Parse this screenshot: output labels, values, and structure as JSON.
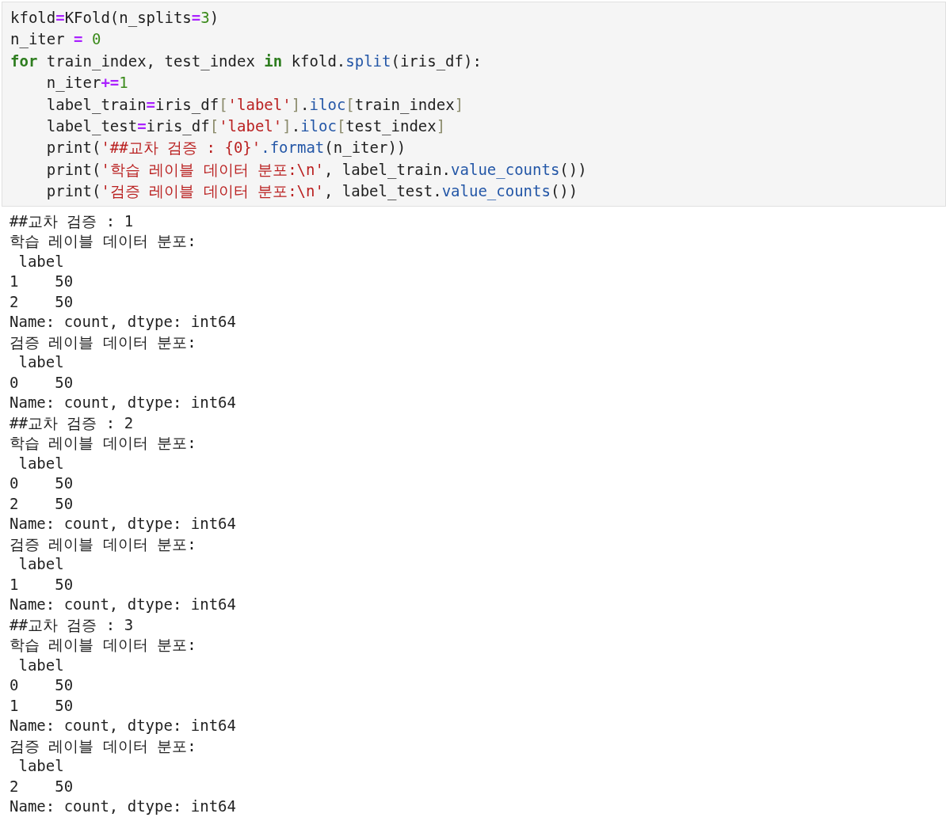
{
  "code_cell": {
    "lines": [
      [
        {
          "text": "kfold",
          "kind": "plain"
        },
        {
          "text": "=",
          "kind": "operator"
        },
        {
          "text": "KFold(n_splits",
          "kind": "plain"
        },
        {
          "text": "=",
          "kind": "operator"
        },
        {
          "text": "3",
          "kind": "number"
        },
        {
          "text": ")",
          "kind": "plain"
        }
      ],
      [
        {
          "text": "n_iter ",
          "kind": "plain"
        },
        {
          "text": "=",
          "kind": "operator"
        },
        {
          "text": " 0",
          "kind": "number"
        }
      ],
      [
        {
          "text": "for",
          "kind": "keyword"
        },
        {
          "text": " train_index, test_index ",
          "kind": "plain"
        },
        {
          "text": "in",
          "kind": "keyword"
        },
        {
          "text": " kfold.",
          "kind": "plain"
        },
        {
          "text": "split",
          "kind": "method"
        },
        {
          "text": "(iris_df):",
          "kind": "plain"
        }
      ],
      [
        {
          "text": "    n_iter",
          "kind": "plain"
        },
        {
          "text": "+=",
          "kind": "operator"
        },
        {
          "text": "1",
          "kind": "number"
        }
      ],
      [
        {
          "text": "    label_train",
          "kind": "plain"
        },
        {
          "text": "=",
          "kind": "operator"
        },
        {
          "text": "iris_df",
          "kind": "plain"
        },
        {
          "text": "[",
          "kind": "bracket"
        },
        {
          "text": "'label'",
          "kind": "string"
        },
        {
          "text": "]",
          "kind": "bracket"
        },
        {
          "text": ".",
          "kind": "plain"
        },
        {
          "text": "iloc",
          "kind": "method"
        },
        {
          "text": "[",
          "kind": "bracket"
        },
        {
          "text": "train_index",
          "kind": "plain"
        },
        {
          "text": "]",
          "kind": "bracket"
        }
      ],
      [
        {
          "text": "    label_test",
          "kind": "plain"
        },
        {
          "text": "=",
          "kind": "operator"
        },
        {
          "text": "iris_df",
          "kind": "plain"
        },
        {
          "text": "[",
          "kind": "bracket"
        },
        {
          "text": "'label'",
          "kind": "string"
        },
        {
          "text": "]",
          "kind": "bracket"
        },
        {
          "text": ".",
          "kind": "plain"
        },
        {
          "text": "iloc",
          "kind": "method"
        },
        {
          "text": "[",
          "kind": "bracket"
        },
        {
          "text": "test_index",
          "kind": "plain"
        },
        {
          "text": "]",
          "kind": "bracket"
        }
      ],
      [
        {
          "text": "    print(",
          "kind": "plain"
        },
        {
          "text": "'##교차 검증 : {0}'",
          "kind": "string"
        },
        {
          "text": ".format",
          "kind": "method"
        },
        {
          "text": "(n_iter))",
          "kind": "plain"
        }
      ],
      [
        {
          "text": "    print(",
          "kind": "plain"
        },
        {
          "text": "'학습 레이블 데이터 분포:\\n'",
          "kind": "string"
        },
        {
          "text": ", label_train.",
          "kind": "plain"
        },
        {
          "text": "value_counts",
          "kind": "method"
        },
        {
          "text": "())",
          "kind": "plain"
        }
      ],
      [
        {
          "text": "    print(",
          "kind": "plain"
        },
        {
          "text": "'검증 레이블 데이터 분포:\\n'",
          "kind": "string"
        },
        {
          "text": ", label_test.",
          "kind": "plain"
        },
        {
          "text": "value_counts",
          "kind": "method"
        },
        {
          "text": "())",
          "kind": "plain"
        }
      ]
    ]
  },
  "output": {
    "lines": [
      "##교차 검증 : 1",
      "학습 레이블 데이터 분포:",
      " label",
      "1    50",
      "2    50",
      "Name: count, dtype: int64",
      "검증 레이블 데이터 분포:",
      " label",
      "0    50",
      "Name: count, dtype: int64",
      "##교차 검증 : 2",
      "학습 레이블 데이터 분포:",
      " label",
      "0    50",
      "2    50",
      "Name: count, dtype: int64",
      "검증 레이블 데이터 분포:",
      " label",
      "1    50",
      "Name: count, dtype: int64",
      "##교차 검증 : 3",
      "학습 레이블 데이터 분포:",
      " label",
      "0    50",
      "1    50",
      "Name: count, dtype: int64",
      "검증 레이블 데이터 분포:",
      " label",
      "2    50",
      "Name: count, dtype: int64"
    ]
  }
}
